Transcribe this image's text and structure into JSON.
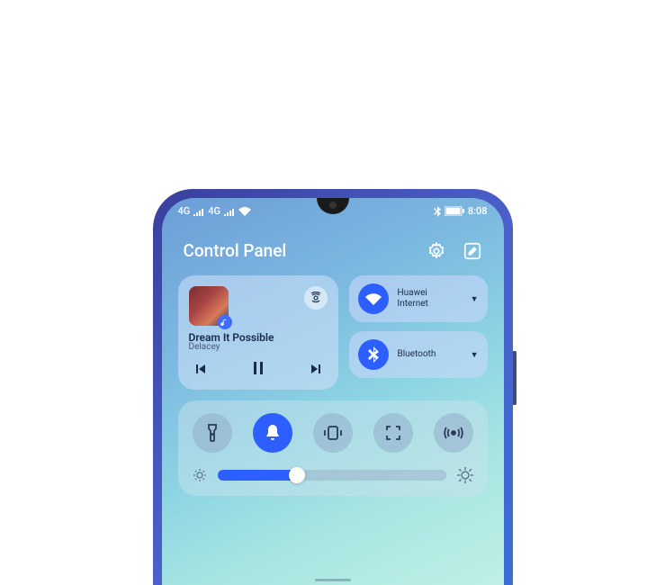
{
  "status": {
    "signal_label": "4G",
    "time": "8:08"
  },
  "header": {
    "title": "Control Panel",
    "settings_icon": "gear-icon",
    "edit_icon": "edit-icon"
  },
  "music": {
    "title": "Dream It Possible",
    "artist": "Delacey",
    "cast_icon": "cast-icon",
    "album_badge_icon": "music-note-icon"
  },
  "wifi": {
    "label": "Huawei\nInternet",
    "on": true
  },
  "bluetooth": {
    "label": "Bluetooth",
    "on": true
  },
  "toggles": {
    "flashlight": {
      "on": false,
      "icon": "flashlight-icon"
    },
    "sound": {
      "on": true,
      "icon": "bell-icon"
    },
    "vibrate": {
      "on": false,
      "icon": "vibrate-icon"
    },
    "screenshot": {
      "on": false,
      "icon": "screenshot-icon"
    },
    "hotspot": {
      "on": false,
      "icon": "hotspot-icon"
    }
  },
  "brightness": {
    "value_pct": 35
  },
  "colors": {
    "accent": "#2d5eff"
  }
}
